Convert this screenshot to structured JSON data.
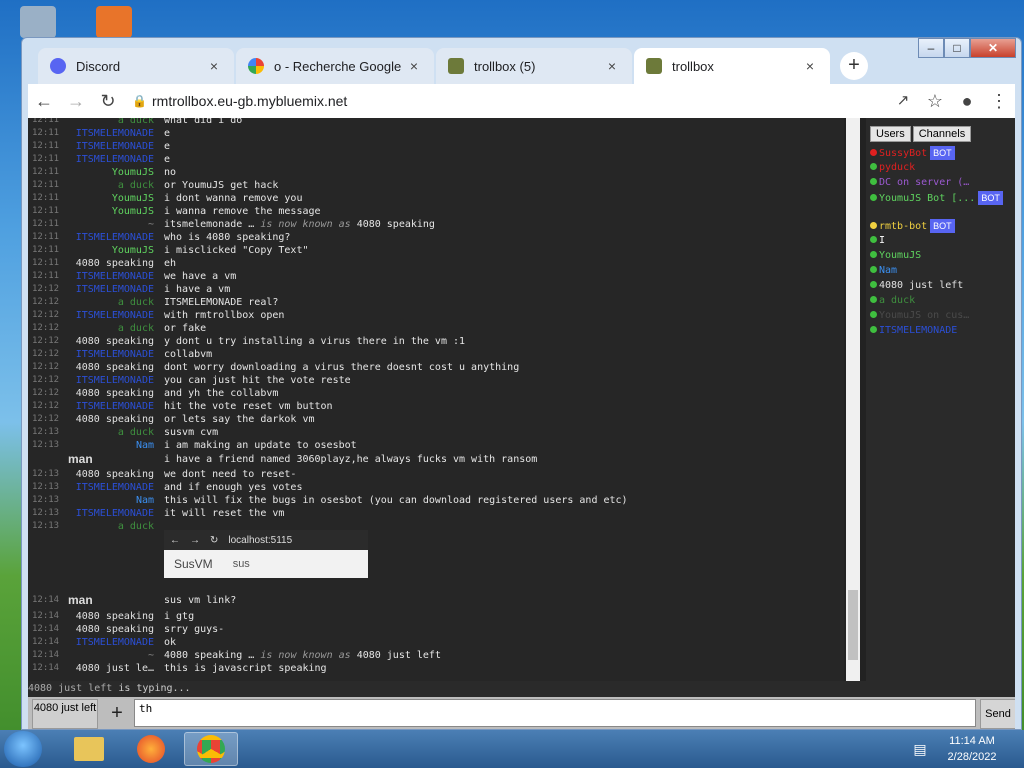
{
  "browser": {
    "tabs": [
      {
        "label": "Discord",
        "icon": "discord-icon",
        "active": false
      },
      {
        "label": "o - Recherche Google",
        "icon": "google-icon",
        "active": false
      },
      {
        "label": "trollbox (5)",
        "icon": "trollbox-icon",
        "active": false
      },
      {
        "label": "trollbox",
        "icon": "trollbox-icon",
        "active": true
      }
    ],
    "new_tab_label": "+",
    "close_glyph": "×",
    "url": "rmtrollbox.eu-gb.mybluemix.net"
  },
  "chat": {
    "messages": [
      {
        "ts": "12:11",
        "nick": "a duck",
        "color": "#3f8f3f",
        "text": "what did i do"
      },
      {
        "ts": "12:11",
        "nick": "ITSMELEMONADE",
        "color": "#2b4fd6",
        "text": "e"
      },
      {
        "ts": "12:11",
        "nick": "ITSMELEMONADE",
        "color": "#2b4fd6",
        "text": "e"
      },
      {
        "ts": "12:11",
        "nick": "ITSMELEMONADE",
        "color": "#2b4fd6",
        "text": "e"
      },
      {
        "ts": "12:11",
        "nick": "YoumuJS",
        "color": "#5fd35f",
        "text": "no"
      },
      {
        "ts": "12:11",
        "nick": "a duck",
        "color": "#3f8f3f",
        "text": "or YoumuJS get hack"
      },
      {
        "ts": "12:11",
        "nick": "YoumuJS",
        "color": "#5fd35f",
        "text": "i dont wanna remove you"
      },
      {
        "ts": "12:11",
        "nick": "YoumuJS",
        "color": "#5fd35f",
        "text": "i wanna remove the message"
      },
      {
        "ts": "12:11",
        "nick": "~",
        "color": "#888888",
        "text": "itsmelemonade",
        "rename": true,
        "renamed_label": "is now known as",
        "renamed_to": "4080 speaking"
      },
      {
        "ts": "12:11",
        "nick": "ITSMELEMONADE",
        "color": "#2b4fd6",
        "text": "who is 4080 speaking?"
      },
      {
        "ts": "12:11",
        "nick": "YoumuJS",
        "color": "#5fd35f",
        "text": "i misclicked \"Copy Text\""
      },
      {
        "ts": "12:11",
        "nick": "4080 speaking",
        "color": "#e0e0e0",
        "text": "eh"
      },
      {
        "ts": "12:11",
        "nick": "ITSMELEMONADE",
        "color": "#2b4fd6",
        "text": "we have a vm"
      },
      {
        "ts": "12:12",
        "nick": "ITSMELEMONADE",
        "color": "#2b4fd6",
        "text": "i have a vm"
      },
      {
        "ts": "12:12",
        "nick": "a duck",
        "color": "#3f8f3f",
        "text": "ITSMELEMONADE real?"
      },
      {
        "ts": "12:12",
        "nick": "ITSMELEMONADE",
        "color": "#2b4fd6",
        "text": "with rmtrollbox open"
      },
      {
        "ts": "12:12",
        "nick": "a duck",
        "color": "#3f8f3f",
        "text": "or fake"
      },
      {
        "ts": "12:12",
        "nick": "4080 speaking",
        "color": "#e0e0e0",
        "text": "y dont u try installing a virus there in the vm :1"
      },
      {
        "ts": "12:12",
        "nick": "ITSMELEMONADE",
        "color": "#2b4fd6",
        "text": "collabvm"
      },
      {
        "ts": "12:12",
        "nick": "4080 speaking",
        "color": "#e0e0e0",
        "text": "dont worry downloading a virus there doesnt cost u anything"
      },
      {
        "ts": "12:12",
        "nick": "ITSMELEMONADE",
        "color": "#2b4fd6",
        "text": "you can just hit the vote reste"
      },
      {
        "ts": "12:12",
        "nick": "4080 speaking",
        "color": "#e0e0e0",
        "text": "and yh the collabvm"
      },
      {
        "ts": "12:12",
        "nick": "ITSMELEMONADE",
        "color": "#2b4fd6",
        "text": "hit the vote reset vm button"
      },
      {
        "ts": "12:12",
        "nick": "4080 speaking",
        "color": "#e0e0e0",
        "text": "or lets say the darkok vm"
      },
      {
        "ts": "12:13",
        "nick": "a duck",
        "color": "#3f8f3f",
        "text": "susvm cvm"
      },
      {
        "ts": "12:13",
        "nick": "Nam",
        "color": "#3b8ff0",
        "text": "i am making an update to osesbot"
      },
      {
        "ts": "",
        "nick": "man",
        "color": "#dddddd",
        "text": "i have a friend named 3060playz,he always fucks vm with ransom",
        "big": true
      },
      {
        "ts": "12:13",
        "nick": "4080 speaking",
        "color": "#e0e0e0",
        "text": "we dont need to reset-"
      },
      {
        "ts": "12:13",
        "nick": "ITSMELEMONADE",
        "color": "#2b4fd6",
        "text": "and if enough yes votes"
      },
      {
        "ts": "12:13",
        "nick": "Nam",
        "color": "#3b8ff0",
        "text": "this will fix the bugs in osesbot (you can download registered users and etc)"
      },
      {
        "ts": "12:13",
        "nick": "ITSMELEMONADE",
        "color": "#2b4fd6",
        "text": "it will reset the vm"
      },
      {
        "ts": "12:13",
        "nick": "a duck",
        "color": "#3f8f3f",
        "text": ""
      }
    ],
    "embed": {
      "url": "localhost:5115",
      "title": "SusVM",
      "subtitle": "sus"
    },
    "messages_after": [
      {
        "ts": "12:14",
        "nick": "man",
        "color": "#dddddd",
        "text": "sus vm link?",
        "big": true
      },
      {
        "ts": "12:14",
        "nick": "4080 speaking",
        "color": "#e0e0e0",
        "text": "i gtg"
      },
      {
        "ts": "12:14",
        "nick": "4080 speaking",
        "color": "#e0e0e0",
        "text": "srry guys-"
      },
      {
        "ts": "12:14",
        "nick": "ITSMELEMONADE",
        "color": "#2b4fd6",
        "text": "ok"
      },
      {
        "ts": "12:14",
        "nick": "~",
        "color": "#888888",
        "text": "4080 speaking",
        "rename": true,
        "renamed_label": "is now known as",
        "renamed_to": "4080 just left"
      },
      {
        "ts": "12:14",
        "nick": "4080 just le…",
        "color": "#e0e0e0",
        "text": "this is javascript speaking"
      }
    ]
  },
  "sidebar": {
    "tabs": [
      "Users",
      "Channels"
    ],
    "users": [
      {
        "name": "SussyBot",
        "color": "#e02020",
        "dot": "#e02020",
        "bot": true
      },
      {
        "name": "pyduck",
        "color": "#e02020",
        "dot": "#3fbf3f"
      },
      {
        "name": "DC on server (…",
        "color": "#9b59d0",
        "dot": "#3fbf3f"
      },
      {
        "name": "YoumuJS Bot [...",
        "color": "#5fd35f",
        "dot": "#3fbf3f",
        "bot": true
      },
      {
        "name": "rmtb-bot",
        "color": "#f0d040",
        "dot": "#f0d040",
        "bot": true
      },
      {
        "name": "I",
        "color": "#ffffff",
        "dot": "#3fbf3f"
      },
      {
        "name": "YoumuJS",
        "color": "#5fd35f",
        "dot": "#3fbf3f"
      },
      {
        "name": "Nam",
        "color": "#3b8ff0",
        "dot": "#3fbf3f"
      },
      {
        "name": "4080 just left",
        "color": "#e0e0e0",
        "dot": "#3fbf3f"
      },
      {
        "name": "a duck",
        "color": "#3f8f3f",
        "dot": "#3fbf3f"
      },
      {
        "name": "YoumuJS on cus…",
        "color": "#4a4a4a",
        "dot": "#3fbf3f"
      },
      {
        "name": "ITSMELEMONADE",
        "color": "#2b4fd6",
        "dot": "#3fbf3f"
      }
    ],
    "bot_label": "BOT"
  },
  "typing": {
    "nick": "4080 just left",
    "label": "is typing..."
  },
  "input": {
    "nick_button": "4080 just left",
    "plus": "+",
    "value": "th",
    "send": "Send"
  },
  "taskbar": {
    "time": "11:14 AM",
    "date": "2/28/2022"
  }
}
